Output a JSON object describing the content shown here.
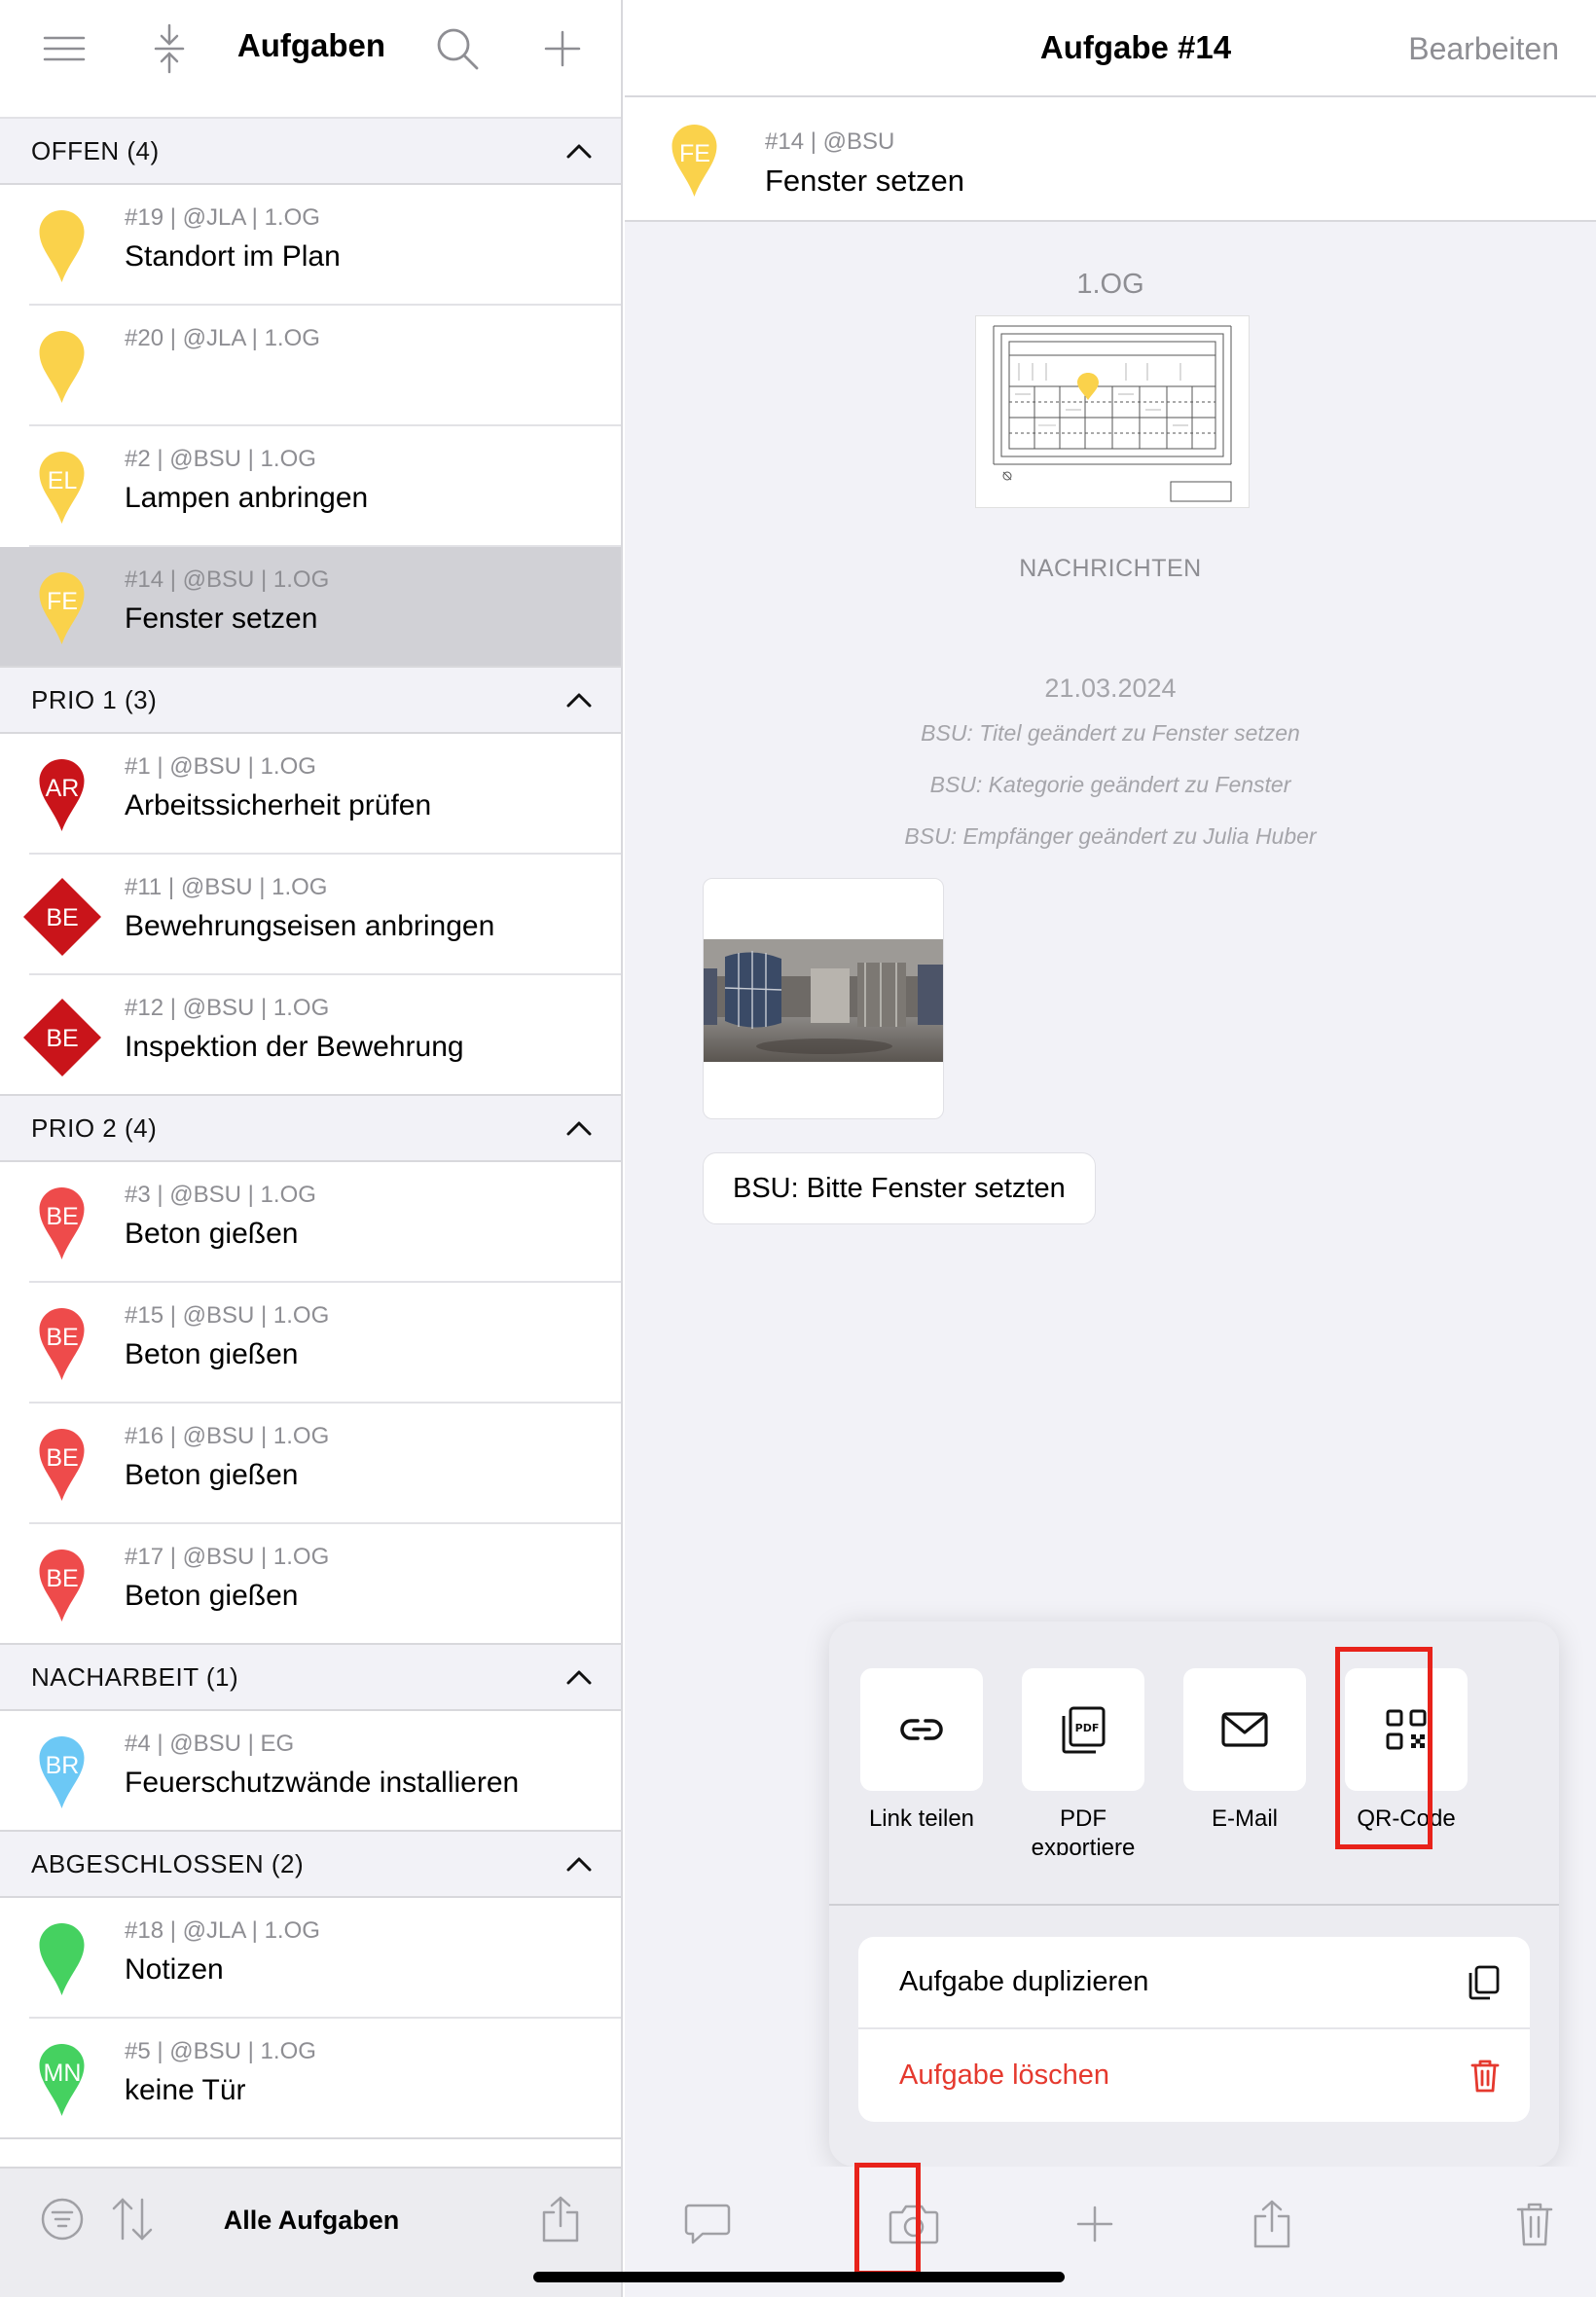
{
  "left": {
    "title": "Aufgaben",
    "header_icons": [
      "menu-icon",
      "collapse-icon",
      "search-icon",
      "plus-icon"
    ],
    "sections": [
      {
        "label": "OFFEN (4)",
        "tasks": [
          {
            "meta": "#19 | @JLA | 1.OG",
            "title": "Standort im Plan",
            "pin_text": "",
            "pin_color": "#fad24b",
            "pin_shape": "drop",
            "selected": false
          },
          {
            "meta": "#20 | @JLA | 1.OG",
            "title": "",
            "pin_text": "",
            "pin_color": "#fad24b",
            "pin_shape": "drop",
            "selected": false
          },
          {
            "meta": "#2 | @BSU | 1.OG",
            "title": "Lampen anbringen",
            "pin_text": "EL",
            "pin_color": "#fad24b",
            "pin_shape": "drop",
            "selected": false
          },
          {
            "meta": "#14 | @BSU | 1.OG",
            "title": "Fenster setzen",
            "pin_text": "FE",
            "pin_color": "#fad24b",
            "pin_shape": "drop",
            "selected": true
          }
        ]
      },
      {
        "label": "PRIO 1 (3)",
        "tasks": [
          {
            "meta": "#1 | @BSU | 1.OG",
            "title": "Arbeitssicherheit prüfen",
            "pin_text": "AR",
            "pin_color": "#c9141a",
            "pin_shape": "drop",
            "selected": false
          },
          {
            "meta": "#11 | @BSU | 1.OG",
            "title": "Bewehrungseisen anbringen",
            "pin_text": "BE",
            "pin_color": "#c9141a",
            "pin_shape": "diamond",
            "selected": false
          },
          {
            "meta": "#12 | @BSU | 1.OG",
            "title": "Inspektion der Bewehrung",
            "pin_text": "BE",
            "pin_color": "#c9141a",
            "pin_shape": "diamond",
            "selected": false
          }
        ]
      },
      {
        "label": "PRIO 2 (4)",
        "tasks": [
          {
            "meta": "#3 | @BSU | 1.OG",
            "title": "Beton gießen",
            "pin_text": "BE",
            "pin_color": "#ee4b4b",
            "pin_shape": "drop",
            "selected": false
          },
          {
            "meta": "#15 | @BSU | 1.OG",
            "title": "Beton gießen",
            "pin_text": "BE",
            "pin_color": "#ee4b4b",
            "pin_shape": "drop",
            "selected": false
          },
          {
            "meta": "#16 | @BSU | 1.OG",
            "title": "Beton gießen",
            "pin_text": "BE",
            "pin_color": "#ee4b4b",
            "pin_shape": "drop",
            "selected": false
          },
          {
            "meta": "#17 | @BSU | 1.OG",
            "title": "Beton gießen",
            "pin_text": "BE",
            "pin_color": "#ee4b4b",
            "pin_shape": "drop",
            "selected": false
          }
        ]
      },
      {
        "label": "NACHARBEIT (1)",
        "tasks": [
          {
            "meta": "#4 | @BSU | EG",
            "title": "Feuerschutzwände installieren",
            "pin_text": "BR",
            "pin_color": "#6cc8f5",
            "pin_shape": "drop",
            "selected": false
          }
        ]
      },
      {
        "label": "ABGESCHLOSSEN (2)",
        "tasks": [
          {
            "meta": "#18 | @JLA | 1.OG",
            "title": "Notizen",
            "pin_text": "",
            "pin_color": "#45d160",
            "pin_shape": "drop",
            "selected": false
          },
          {
            "meta": "#5 | @BSU | 1.OG",
            "title": "keine Tür",
            "pin_text": "MN",
            "pin_color": "#45d160",
            "pin_shape": "drop",
            "selected": false
          }
        ]
      }
    ],
    "bottom": {
      "label": "Alle Aufgaben"
    }
  },
  "right": {
    "title": "Aufgabe #14",
    "edit_label": "Bearbeiten",
    "card": {
      "meta": "#14 | @BSU",
      "title": "Fenster setzen",
      "pin_text": "FE",
      "pin_color": "#fad24b"
    },
    "plan_label": "1.OG",
    "messages_label": "NACHRICHTEN",
    "date": "21.03.2024",
    "system_messages": [
      "BSU: Titel geändert zu Fenster setzen",
      "BSU: Kategorie geändert zu Fenster",
      "BSU: Empfänger geändert zu Julia Huber"
    ],
    "chat_message": "BSU: Bitte Fenster setzten",
    "share": {
      "options": [
        {
          "label": "Link teilen",
          "icon": "link-icon"
        },
        {
          "label": "PDF exportiere n",
          "icon": "pdf-icon"
        },
        {
          "label": "E-Mail",
          "icon": "mail-icon"
        },
        {
          "label": "QR-Code",
          "icon": "qr-code-icon"
        }
      ],
      "duplicate_label": "Aufgabe duplizieren",
      "delete_label": "Aufgabe löschen"
    },
    "toolbar_icons": [
      "comment-icon",
      "camera-icon",
      "plus-icon",
      "share-icon",
      "trash-icon"
    ]
  },
  "colors": {
    "accent_red": "#e8221a",
    "delete_red": "#e5392e",
    "secondary_text": "#8e8e93",
    "selected_row": "#d1d1d6"
  }
}
